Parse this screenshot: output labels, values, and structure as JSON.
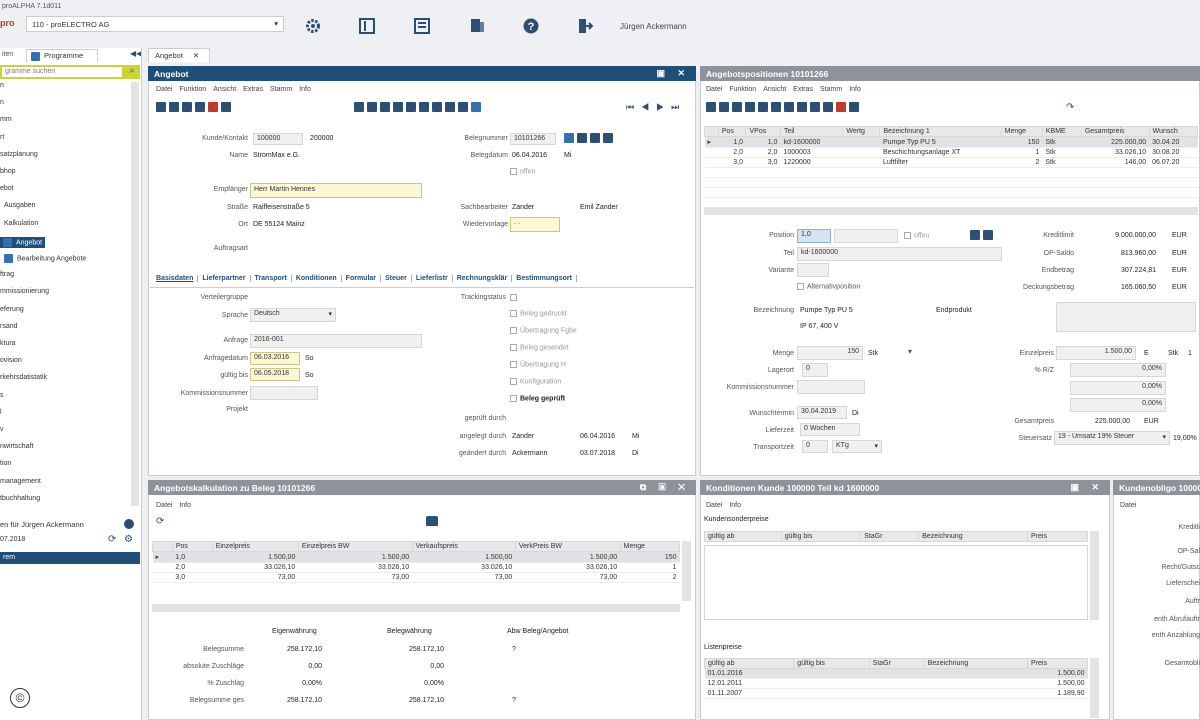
{
  "window_title": "proALPHA 7.1d011",
  "company_select": "110 - proELECTRO AG",
  "user_name": "Jürgen Ackermann",
  "icons": [
    "gear-icon",
    "panel-icon",
    "report-icon",
    "print-icon",
    "help-icon",
    "exit-icon"
  ],
  "sidebar": {
    "tab1": "iten",
    "tab2": "Programme",
    "search_placeholder": "gramme suchen",
    "items": [
      "n",
      "n",
      "mm",
      "rt",
      "satzplanung",
      "bhop",
      "ebot",
      "Ausgaben",
      "Kalkulation",
      "Angebot",
      "Bearbeitung Angebote",
      "ftrag",
      "mmissionierung",
      "eferung",
      "rsand",
      "ktura",
      "ovision",
      "rkehrsdatistatik",
      "s",
      "l",
      "v",
      "nwirtschaft",
      "tion",
      "management",
      "tbuchhaltung"
    ],
    "selected_index": 9,
    "user_line": "en für Jürgen Ackermann",
    "date": "07.2018",
    "bottom_item": "rem"
  },
  "doc_tab": "Angebot",
  "angebot": {
    "title": "Angebot",
    "menu": [
      "Datei",
      "Funktion",
      "Ansicht",
      "Extras",
      "Stamm",
      "Info"
    ],
    "fields": {
      "kunde_label": "Kunde/Kontakt",
      "kunde_val1": "100000",
      "kunde_val2": "200000",
      "name_label": "Name",
      "name_val": "StromMax e.G.",
      "empfaenger_label": "Empfänger",
      "empfaenger_val": "Herr Martin Hennes",
      "strasse_label": "Straße",
      "strasse_val": "Raiffeisenstraße 5",
      "ort_label": "Ort",
      "ort_val": "DE 55124 Mainz",
      "auftragsart_label": "Auftragsart",
      "belegnr_label": "Belegnummer",
      "belegnr_val": "10101266",
      "belegdatum_label": "Belegdatum",
      "belegdatum_val": "06.04.2016",
      "belegdatum_day": "Mi",
      "offen_label": "offen",
      "sachbearbeiter_label": "Sachbearbeiter",
      "sachbearbeiter_val1": "Zander",
      "sachbearbeiter_val2": "Emil Zander",
      "wiedervorlage_label": "Wiedervorlage",
      "wiedervorlage_val": ". ."
    },
    "tabs": [
      "Basisdaten",
      "Lieferpartner",
      "Transport",
      "Konditionen",
      "Formular",
      "Steuer",
      "Lieferlistr",
      "Rechnungsklär",
      "Bestimmungsort"
    ],
    "basis": {
      "verteilergruppe_label": "Verteilergruppe",
      "sprache_label": "Sprache",
      "sprache_val": "Deutsch",
      "anfrage_label": "Anfrage",
      "anfrage_val": "2016-001",
      "anfragedatum_label": "Anfragedatum",
      "anfragedatum_val": "06.03.2016",
      "anfragedatum_day": "So",
      "gueltig_label": "gültig bis",
      "gueltig_val": "06.05.2018",
      "gueltig_day": "So",
      "kommission_label": "Kommissionsnummer",
      "projekt_label": "Projekt",
      "tracking_label": "Trackingstatus",
      "checks": [
        "Beleg gedruckt",
        "Übertragung Fgbe",
        "Beleg gesendet",
        "Übertragung H",
        "Konfiguration",
        "Beleg geprüft"
      ],
      "geprueft_label": "geprüft durch",
      "angelegt_label": "angelegt durch",
      "angelegt_val": "Zander",
      "angelegt_date": "06.04.2016",
      "angelegt_day": "Mi",
      "geaendert_label": "geändert durch",
      "geaendert_val": "Ackermann",
      "geaendert_date": "03.07.2018",
      "geaendert_day": "Di"
    }
  },
  "positionen": {
    "title": "Angebotspositionen 10101266",
    "menu": [
      "Datei",
      "Funktion",
      "Ansicht",
      "Extras",
      "Stamm",
      "Info"
    ],
    "columns": [
      "Pos",
      "VPos",
      "Teil",
      "Wertg",
      "Bezeichnung 1",
      "Menge",
      "KBME",
      "Gesamtpreis",
      "Wunsch"
    ],
    "rows": [
      [
        "1,0",
        "1,0",
        "kd-1600000",
        "",
        "Pumpe Typ PU 5",
        "150",
        "Stk",
        "225.000,00",
        "30.04.20"
      ],
      [
        "2,0",
        "2,0",
        "1000003",
        "",
        "Beschichtungsanlage XT",
        "1",
        "Stk",
        "33.026,10",
        "30.08.20"
      ],
      [
        "3,0",
        "3,0",
        "1220000",
        "",
        "Luftfilter",
        "2",
        "Stk",
        "146,00",
        "06.07.20"
      ]
    ],
    "detail": {
      "position_label": "Position",
      "position_val": "1,0",
      "offen_label": "offen",
      "teil_label": "Teil",
      "teil_val": "kd-1600000",
      "variante_label": "Variante",
      "alternativ_label": "Alternativposition",
      "bezeichnung_label": "Bezeichnung",
      "bezeichnung_val": "Pumpe Typ PU 5",
      "bezeichnung_val2": "IP 67, 400 V",
      "endprodukt_label": "Endprodukt",
      "menge_label": "Menge",
      "menge_val": "150",
      "menge_unit": "Stk",
      "lagerort_label": "Lagerort",
      "lagerort_val": "0",
      "kommission_label": "Kommissionsnummer",
      "wunschtermin_label": "Wunschtermin",
      "wunschtermin_val": "30.04.2019",
      "wunschtermin_day": "Di",
      "lieferzeit_label": "Lieferzeit",
      "lieferzeit_val": "0",
      "lieferzeit_unit": "Wochen",
      "transport_label": "Transportzeit",
      "transport_val": "0",
      "transport_unit": "KTg",
      "kreditlimit_label": "Kreditlimit",
      "kreditlimit_val": "9.000.000,00",
      "op_saldo_label": "OP-Saldo",
      "op_saldo_val": "813.960,00",
      "endbetrag_label": "Endbetrag",
      "endbetrag_val": "307.224,81",
      "deckung_label": "Deckungsbetrag",
      "deckung_val": "165.060,50",
      "currency": "EUR",
      "einzelpreis_label": "Einzelpreis",
      "einzelpreis_val": "1.500,00",
      "einzelpreis_cur": "E",
      "einzelpreis_unit": "Stk",
      "einzelpreis_n": "1",
      "rabatt_label": "% R/Z",
      "rabatt_vals": [
        "0,00%",
        "0,00%",
        "0,00%"
      ],
      "gesamtpreis_label": "Gesamtpreis",
      "gesamtpreis_val": "225.000,00",
      "steuersatz_label": "Steuersatz",
      "steuersatz_val": "19 - Umsatz 19% Steuer",
      "steuersatz_pct": "19,00%"
    }
  },
  "kalkulation": {
    "title": "Angebotskalkulation zu Beleg 10101266",
    "menu": [
      "Datei",
      "Info"
    ],
    "columns": [
      "Pos",
      "Einzelpreis",
      "Einzelpreis BW",
      "Verkaufspreis",
      "VerkPreis BW",
      "Menge"
    ],
    "rows": [
      [
        "1,0",
        "1.500,00",
        "1.500,00",
        "1.500,00",
        "1.500,00",
        "150"
      ],
      [
        "2,0",
        "33.026,10",
        "33.026,10",
        "33.026,10",
        "33.026,10",
        "1"
      ],
      [
        "3,0",
        "73,00",
        "73,00",
        "73,00",
        "73,00",
        "2"
      ]
    ],
    "summary_headers": [
      "Eigenwährung",
      "Belegwährung",
      "Abw Beleg/Angebot"
    ],
    "summary_rows": [
      {
        "label": "Belegsumme",
        "v1": "258.172,10",
        "v2": "258.172,10",
        "v3": "?"
      },
      {
        "label": "absolute Zuschläge",
        "v1": "0,00",
        "v2": "0,00",
        "v3": ""
      },
      {
        "label": "% Zuschlag",
        "v1": "0,00%",
        "v2": "0,00%",
        "v3": ""
      },
      {
        "label": "Belegsumme ges",
        "v1": "258.172,10",
        "v2": "258.172,10",
        "v3": "?"
      }
    ]
  },
  "konditionen": {
    "title": "Konditionen Kunde 100000 Teil kd 1600000",
    "menu": [
      "Datei",
      "Info"
    ],
    "kundensonderpreise": "Kundensonderpreise",
    "columns": [
      "gültig ab",
      "gültig bis",
      "StaGr",
      "Bezeichnung",
      "Preis"
    ],
    "listenpreise": "Listenpreise",
    "list_rows": [
      [
        "01.01.2016",
        "",
        "",
        "",
        "1.500,00"
      ],
      [
        "12.01.2011",
        "",
        "",
        "",
        "1.500,00"
      ],
      [
        "01.11.2007",
        "",
        "",
        "",
        "1.189,90"
      ]
    ]
  },
  "kundenobligo": {
    "title": "Kundenobligo 100000",
    "menu": [
      "Datei"
    ],
    "labels": [
      "Kreditli",
      "OP-Sal",
      "Recht/Gutsc",
      "Lieferschei",
      "Auftr",
      "enth Abrufauftr",
      "enth Anzahlung",
      "Gesamtobli"
    ]
  },
  "copyright": "©"
}
